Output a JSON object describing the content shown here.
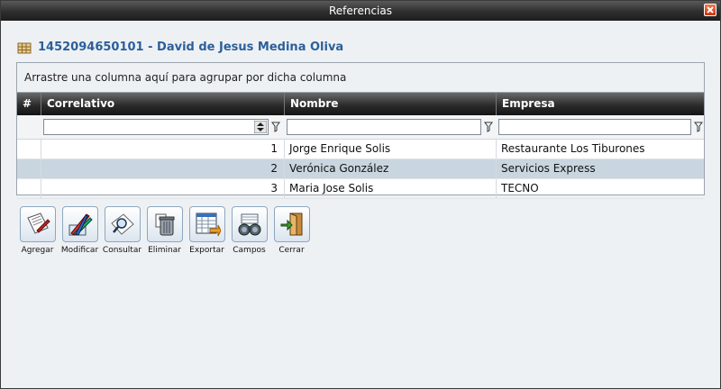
{
  "window": {
    "title": "Referencias"
  },
  "header": {
    "title": "1452094650101 - David de Jesus Medina Oliva"
  },
  "grid": {
    "group_hint": "Arrastre una columna aquí para agrupar por dicha columna",
    "columns": [
      "#",
      "Correlativo",
      "Nombre",
      "Empresa"
    ],
    "rows": [
      {
        "correlativo": "1",
        "nombre": "Jorge Enrique Solis",
        "empresa": "Restaurante Los Tiburones"
      },
      {
        "correlativo": "2",
        "nombre": "Verónica González",
        "empresa": "Servicios Express"
      },
      {
        "correlativo": "3",
        "nombre": "Maria Jose Solis",
        "empresa": "TECNO"
      }
    ]
  },
  "toolbar": {
    "items": [
      {
        "label": "Agregar",
        "icon": "add-document-icon"
      },
      {
        "label": "Modificar",
        "icon": "edit-pencils-icon"
      },
      {
        "label": "Consultar",
        "icon": "search-document-icon"
      },
      {
        "label": "Eliminar",
        "icon": "trash-icon"
      },
      {
        "label": "Exportar",
        "icon": "export-spreadsheet-icon"
      },
      {
        "label": "Campos",
        "icon": "binoculars-icon"
      },
      {
        "label": "Cerrar",
        "icon": "exit-door-icon"
      }
    ]
  },
  "colors": {
    "header_text": "#2c5f9a",
    "selected_row": "#c9d5df",
    "close_button": "#d9431a"
  }
}
